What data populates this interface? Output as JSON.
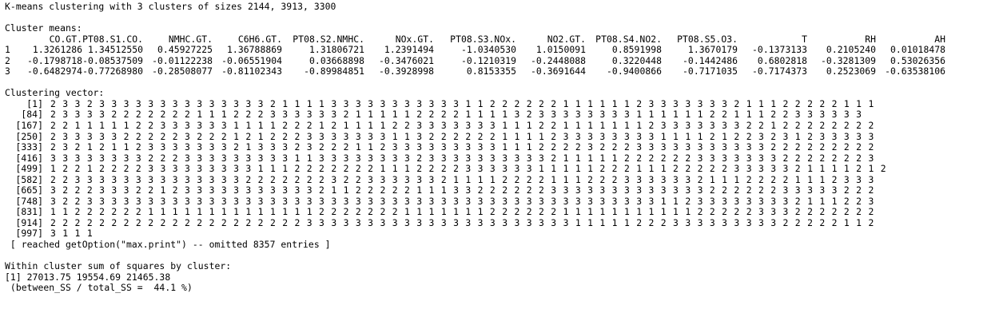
{
  "header": "K-means clustering with 3 clusters of sizes 2144, 3913, 3300",
  "cluster_means": {
    "label": "Cluster means:",
    "columns": [
      "CO.GT.",
      "PT08.S1.CO.",
      "NMHC.GT.",
      "C6H6.GT.",
      "PT08.S2.NMHC.",
      "NOx.GT.",
      "PT08.S3.NOx.",
      "NO2.GT.",
      "PT08.S4.NO2.",
      "PT08.S5.O3.",
      "T",
      "RH",
      "AH"
    ],
    "rows": [
      {
        "name": "1",
        "values": [
          "1.3261286",
          "1.34512550",
          "0.45927225",
          "1.36788869",
          "1.31806721",
          "1.2391494",
          "-1.0340530",
          "1.0150091",
          "0.8591998",
          "1.3670179",
          "-0.1373133",
          "0.2105240",
          "0.01018478"
        ]
      },
      {
        "name": "2",
        "values": [
          "-0.1798718",
          "-0.08537509",
          "-0.01122238",
          "-0.06551904",
          "0.03668898",
          "-0.3476021",
          "-0.1210319",
          "-0.2448088",
          "0.3220448",
          "-0.1442486",
          "0.6802818",
          "-0.3281309",
          "0.53026356"
        ]
      },
      {
        "name": "3",
        "values": [
          "-0.6482974",
          "-0.77268980",
          "-0.28508077",
          "-0.81102343",
          "-0.89984851",
          "-0.3928998",
          "0.8153355",
          "-0.3691644",
          "-0.9400866",
          "-0.7171035",
          "-0.7174373",
          "0.2523069",
          "-0.63538106"
        ]
      }
    ]
  },
  "clustering_vector": {
    "label": "Clustering vector:",
    "rows": [
      {
        "index": "[1]",
        "values": "2 3 3 2 3 3 3 3 3 3 3 3 3 3 3 3 3 3 2 1 1 1 1 3 3 3 3 3 3 3 3 3 3 3 1 1 2 2 2 2 2 2 1 1 1 1 1 1 2 3 3 3 3 3 3 3 2 1 1 1 2 2 2 2 2 1 1 1"
      },
      {
        "index": "[84]",
        "values": "2 3 3 3 3 2 2 2 2 2 2 2 1 1 1 2 2 2 3 3 3 3 3 3 2 1 1 1 1 1 2 2 2 2 1 1 1 1 3 2 3 3 3 3 3 3 3 3 1 1 1 1 1 1 2 2 1 1 1 2 2 3 3 3 3 3 3"
      },
      {
        "index": "[167]",
        "values": "2 2 1 1 1 1 1 2 2 3 3 3 3 3 3 1 1 1 1 2 2 2 1 2 1 1 1 1 2 2 3 3 3 3 3 3 3 1 1 1 2 2 1 1 1 1 1 1 1 2 3 3 3 3 3 3 3 2 2 1 2 2 2 2 2 2 2 2"
      },
      {
        "index": "[250]",
        "values": "2 3 3 3 3 3 2 2 2 2 2 3 2 2 2 1 2 1 2 2 2 3 3 3 3 3 3 3 1 1 3 2 2 2 2 2 2 1 1 1 1 2 3 3 3 3 3 3 3 3 1 1 1 1 2 1 2 2 3 2 3 1 2 3 3 3 3 3"
      },
      {
        "index": "[333]",
        "values": "2 3 2 1 2 1 1 2 3 3 3 3 3 3 3 2 1 3 3 3 2 3 2 2 2 1 1 2 3 3 3 3 3 3 3 3 3 1 1 1 2 2 2 2 3 2 2 2 3 3 3 3 3 3 3 3 3 3 3 2 2 2 2 2 2 2 2 2"
      },
      {
        "index": "[416]",
        "values": "3 3 3 3 3 3 3 3 2 2 2 3 3 3 3 3 3 3 3 3 1 1 3 3 3 3 3 3 3 3 2 3 3 3 3 3 3 3 3 3 3 2 1 1 1 1 1 2 2 2 2 2 2 3 3 3 3 3 3 3 2 2 2 2 2 2 2 3"
      },
      {
        "index": "[499]",
        "values": "1 2 2 1 2 2 2 2 3 3 3 3 3 3 3 3 3 1 1 1 2 2 2 2 2 2 2 1 1 1 2 2 2 2 3 3 3 3 3 3 1 1 1 1 1 2 2 2 1 1 1 2 2 2 2 2 3 3 3 3 3 2 1 1 1 1 2 1 2"
      },
      {
        "index": "[582]",
        "values": "2 2 3 3 3 3 3 3 3 3 3 3 3 3 3 3 2 2 2 2 2 2 2 3 2 2 3 3 3 3 3 3 2 1 1 1 1 2 2 2 2 1 1 1 2 2 2 3 3 3 3 3 3 2 1 1 1 2 2 2 2 1 1 1 2 3 3 3"
      },
      {
        "index": "[665]",
        "values": "3 2 2 2 3 3 3 2 2 1 2 3 3 3 3 3 3 3 3 3 3 3 2 1 1 2 2 2 2 2 1 1 1 3 3 2 2 2 2 2 2 3 3 3 3 3 3 3 3 3 3 3 3 3 2 2 2 2 2 2 3 3 3 3 3 2 2 2"
      },
      {
        "index": "[748]",
        "values": "3 2 2 3 3 3 3 3 3 3 3 3 3 3 3 3 3 3 3 3 3 3 3 3 3 3 3 3 3 3 3 3 3 3 3 3 3 3 3 3 3 3 3 3 3 3 3 3 3 3 1 1 2 3 3 3 3 3 3 3 3 2 1 1 1 2 2 3"
      },
      {
        "index": "[831]",
        "values": "1 1 2 2 2 2 2 2 1 1 1 1 1 1 1 1 1 1 1 1 1 1 2 2 2 2 2 2 2 1 1 1 1 1 1 1 2 2 2 2 2 2 1 1 1 1 1 1 1 1 1 1 1 2 2 2 2 2 3 3 3 2 2 2 2 2 2 2"
      },
      {
        "index": "[914]",
        "values": "2 2 2 2 2 2 2 2 2 2 2 2 2 2 2 2 2 2 2 2 2 3 3 3 3 3 3 3 3 3 3 3 3 3 3 3 3 3 3 3 3 3 3 1 1 1 1 1 2 2 2 3 3 3 3 3 3 3 3 3 2 2 2 2 2 1 1 2"
      },
      {
        "index": "[997]",
        "values": "3 1 1 1"
      }
    ],
    "omitted_note": " [ reached getOption(\"max.print\") -- omitted 8357 entries ]"
  },
  "within_ss": {
    "label": "Within cluster sum of squares by cluster:",
    "values_line": "[1] 27013.75 19554.69 21465.38",
    "ratio_line": " (between_SS / total_SS =  44.1 %)"
  }
}
